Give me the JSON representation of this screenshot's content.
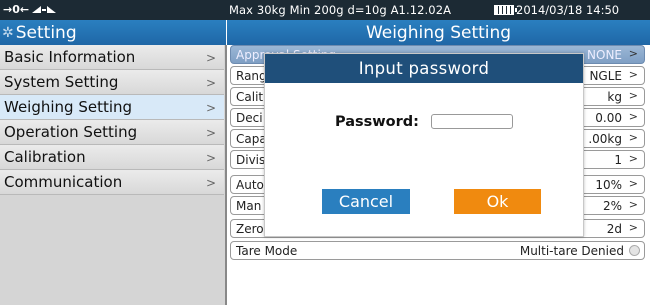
{
  "status": {
    "icons": "→0←",
    "info": "Max 30kg  Min 200g  d=10g   A1.12.02A",
    "datetime": "2014/03/18  14:50"
  },
  "left_header": {
    "title": "Setting"
  },
  "menu": {
    "items": [
      {
        "label": "Basic Information"
      },
      {
        "label": "System Setting"
      },
      {
        "label": "Weighing Setting"
      },
      {
        "label": "Operation Setting"
      },
      {
        "label": "Calibration"
      },
      {
        "label": "Communication"
      }
    ],
    "active_index": 2
  },
  "main": {
    "title": "Weighing Setting",
    "rows": [
      {
        "label": "Approval Setting",
        "value": "NONE"
      },
      {
        "label": "Rang",
        "value": "NGLE"
      },
      {
        "label": "Calit",
        "value": "kg"
      },
      {
        "label": "Deci",
        "value": "0.00"
      },
      {
        "label": "Capa",
        "value": ".00kg"
      },
      {
        "label": "Divis",
        "value": "1"
      },
      {
        "label": "Auto",
        "value": "10%"
      },
      {
        "label": "Man",
        "value": "2%"
      },
      {
        "label": "Zero",
        "value": "2d"
      },
      {
        "label": "Tare Mode",
        "value": "Multi-tare Denied"
      }
    ]
  },
  "dialog": {
    "title": "Input password",
    "password_label": "Password:",
    "password_value": "",
    "cancel_label": "Cancel",
    "ok_label": "Ok"
  },
  "colors": {
    "header_blue": "#1f67a6",
    "dialog_title": "#1f4f7a",
    "cancel_button": "#2a7fbf",
    "ok_button": "#f08a0f",
    "active_menu": "#d8e9f8"
  }
}
